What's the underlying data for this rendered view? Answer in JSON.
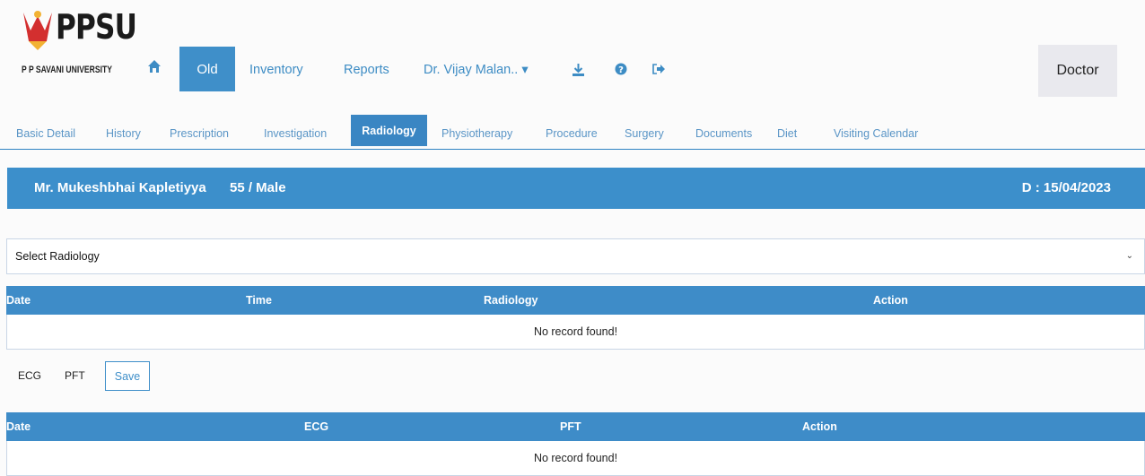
{
  "brand": {
    "name": "PPSU",
    "subtitle": "P P SAVANI UNIVERSITY"
  },
  "nav": {
    "active_label": "Old",
    "links": [
      "Inventory",
      "Reports",
      "Dr. Vijay Malan.. ▾"
    ],
    "role": "Doctor"
  },
  "tabs": {
    "items": [
      "Basic Detail",
      "History",
      "Prescription",
      "Investigation",
      "Radiology",
      "Physiotherapy",
      "Procedure",
      "Surgery",
      "Documents",
      "Diet",
      "Visiting Calendar"
    ],
    "active": "Radiology"
  },
  "patient": {
    "name": "Mr. Mukeshbhai Kapletiyya",
    "age_gender": "55 / Male",
    "date": "D : 15/04/2023"
  },
  "radiology_select": {
    "placeholder": "Select Radiology"
  },
  "radiology_table": {
    "headers": [
      "Date",
      "Time",
      "Radiology",
      "Action"
    ],
    "empty_text": "No record found!"
  },
  "tests": {
    "ecg": "ECG",
    "pft": "PFT",
    "save": "Save"
  },
  "ecg_table": {
    "headers": [
      "Date",
      "ECG",
      "PFT",
      "Action"
    ],
    "empty_text": "No record found!"
  },
  "colors": {
    "primary": "#3c8fcb",
    "link": "#3d8cc4",
    "brand_red": "#d32f2f"
  }
}
